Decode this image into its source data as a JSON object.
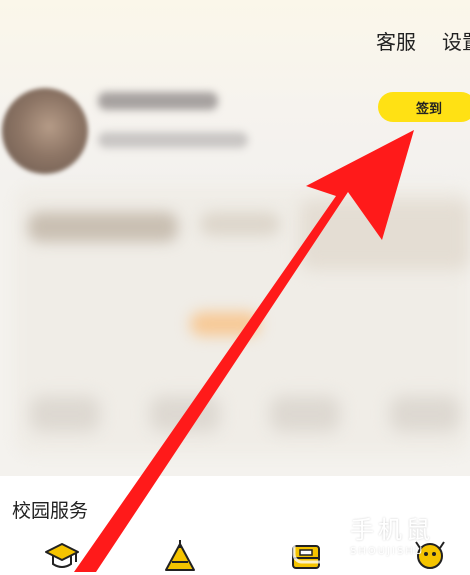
{
  "header": {
    "customer_service_label": "客服",
    "settings_label": "设置"
  },
  "profile": {
    "checkin_label": "签到"
  },
  "campus_services": {
    "title": "校园服务"
  },
  "watermark": {
    "brand": "手机鼠",
    "sub": "SHOUJISHU"
  },
  "colors": {
    "checkin_yellow": "#ffe114",
    "arrow_red": "#ff1a1a",
    "icon_yellow": "#f5c400"
  }
}
